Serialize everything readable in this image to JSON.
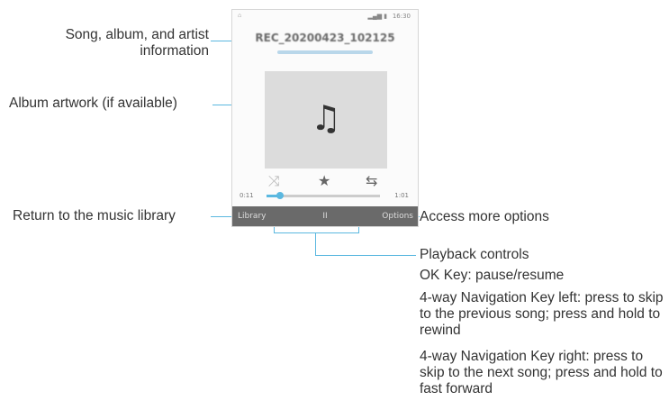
{
  "phone": {
    "status_left": "⌂",
    "status_signal": "▂▄▆ ▮",
    "status_time": "16:30",
    "song_title": "REC_20200423_102125",
    "note_icon": "music-note-icon",
    "controls": {
      "shuffle": "⤨",
      "favorite": "★",
      "repeat": "⇆"
    },
    "progress": {
      "elapsed": "0:11",
      "total": "1:01",
      "fraction": 0.12
    },
    "softkeys": {
      "left": "Library",
      "center": "II",
      "right": "Options"
    }
  },
  "callouts": {
    "song_info": "Song, album, and artist information",
    "artwork": "Album artwork (if available)",
    "return": "Return to the music library",
    "options": "Access more options",
    "playback_title": "Playback controls",
    "ok_key": "OK Key: pause/resume",
    "nav_left": "4-way Navigation Key left: press to skip to the previous song; press and hold to rewind",
    "nav_right": "4-way Navigation Key right: press to skip to the next song; press and hold to fast forward"
  },
  "colors": {
    "leader": "#5bb8e0",
    "softkey_bar": "#6a6a6a"
  }
}
